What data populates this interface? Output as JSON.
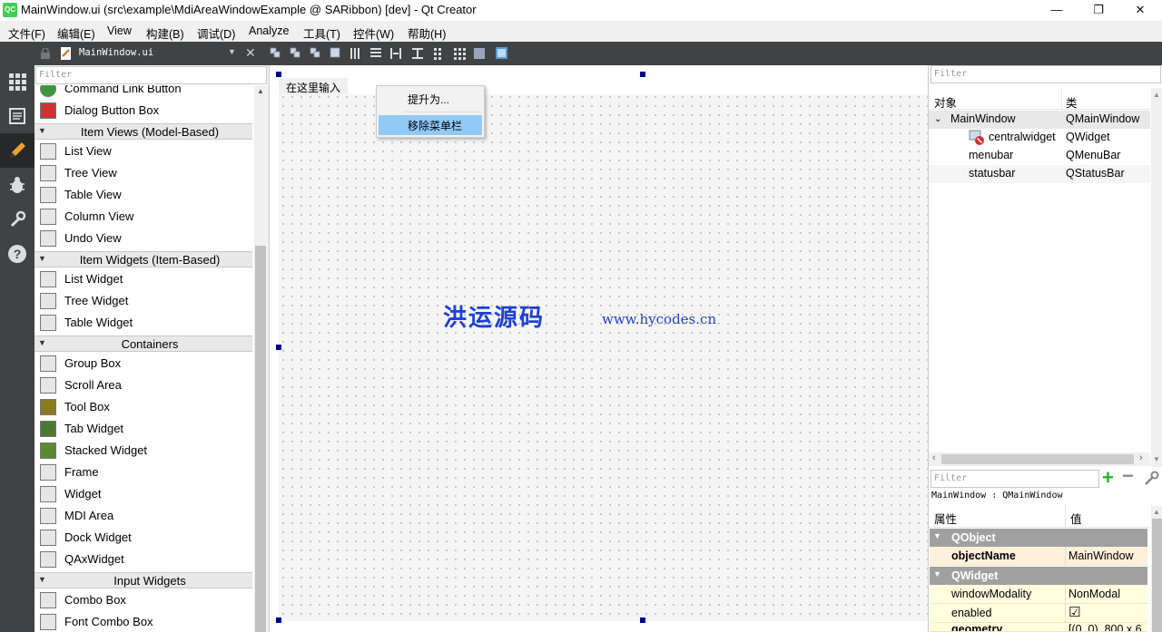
{
  "window": {
    "title": "MainWindow.ui (src\\example\\MdiAreaWindowExample @ SARibbon) [dev] - Qt Creator",
    "app_icon_label": "QC",
    "minimize": "—",
    "restore": "❐",
    "close": "✕"
  },
  "menubar": [
    "文件(F)",
    "编辑(E)",
    "View",
    "构建(B)",
    "调试(D)",
    "Analyze",
    "工具(T)",
    "控件(W)",
    "帮助(H)"
  ],
  "modes": [
    "welcome-icon",
    "edit-icon",
    "design-icon",
    "debug-icon",
    "projects-icon",
    "help-icon"
  ],
  "widgetbox": {
    "document_name": "MainWindow.ui",
    "filter_placeholder": "Filter",
    "items": [
      {
        "type": "item",
        "label": "Command Link Button",
        "icon": "command-link-button-icon"
      },
      {
        "type": "item",
        "label": "Dialog Button Box",
        "icon": "dialog-button-box-icon"
      },
      {
        "type": "cat",
        "label": "Item Views (Model-Based)"
      },
      {
        "type": "item",
        "label": "List View",
        "icon": "list-view-icon"
      },
      {
        "type": "item",
        "label": "Tree View",
        "icon": "tree-view-icon"
      },
      {
        "type": "item",
        "label": "Table View",
        "icon": "table-view-icon"
      },
      {
        "type": "item",
        "label": "Column View",
        "icon": "column-view-icon"
      },
      {
        "type": "item",
        "label": "Undo View",
        "icon": "undo-view-icon"
      },
      {
        "type": "cat",
        "label": "Item Widgets (Item-Based)"
      },
      {
        "type": "item",
        "label": "List Widget",
        "icon": "list-widget-icon"
      },
      {
        "type": "item",
        "label": "Tree Widget",
        "icon": "tree-widget-icon"
      },
      {
        "type": "item",
        "label": "Table Widget",
        "icon": "table-widget-icon"
      },
      {
        "type": "cat",
        "label": "Containers"
      },
      {
        "type": "item",
        "label": "Group Box",
        "icon": "group-box-icon"
      },
      {
        "type": "item",
        "label": "Scroll Area",
        "icon": "scroll-area-icon"
      },
      {
        "type": "item",
        "label": "Tool Box",
        "icon": "tool-box-icon"
      },
      {
        "type": "item",
        "label": "Tab Widget",
        "icon": "tab-widget-icon"
      },
      {
        "type": "item",
        "label": "Stacked Widget",
        "icon": "stacked-widget-icon"
      },
      {
        "type": "item",
        "label": "Frame",
        "icon": "frame-icon"
      },
      {
        "type": "item",
        "label": "Widget",
        "icon": "widget-icon"
      },
      {
        "type": "item",
        "label": "MDI Area",
        "icon": "mdi-area-icon"
      },
      {
        "type": "item",
        "label": "Dock Widget",
        "icon": "dock-widget-icon"
      },
      {
        "type": "item",
        "label": "QAxWidget",
        "icon": "qaxwidget-icon"
      },
      {
        "type": "cat",
        "label": "Input Widgets"
      },
      {
        "type": "item",
        "label": "Combo Box",
        "icon": "combo-box-icon"
      },
      {
        "type": "item",
        "label": "Font Combo Box",
        "icon": "font-combo-box-icon"
      }
    ]
  },
  "form": {
    "menubar_entry": "在这里输入",
    "context_menu": {
      "promote": "提升为...",
      "remove_menubar": "移除菜单栏"
    },
    "watermark_cn": "洪运源码",
    "watermark_url": "www.hycodes.cn"
  },
  "object_inspector": {
    "filter_placeholder": "Filter",
    "col_object": "对象",
    "col_class": "类",
    "rows": [
      {
        "object": "MainWindow",
        "class": "QMainWindow"
      },
      {
        "object": "centralwidget",
        "class": "QWidget"
      },
      {
        "object": "menubar",
        "class": "QMenuBar"
      },
      {
        "object": "statusbar",
        "class": "QStatusBar"
      }
    ]
  },
  "property_editor": {
    "filter_placeholder": "Filter",
    "context": "MainWindow : QMainWindow",
    "col_property": "属性",
    "col_value": "值",
    "sections": [
      {
        "name": "QObject",
        "props": [
          {
            "key": "objectName",
            "value": "MainWindow",
            "bold": true
          }
        ]
      },
      {
        "name": "QWidget",
        "props": [
          {
            "key": "windowModality",
            "value": "NonModal"
          },
          {
            "key": "enabled",
            "value": "☑"
          },
          {
            "key": "geometry",
            "value": "[(0, 0), 800 x 6"
          }
        ]
      }
    ]
  }
}
